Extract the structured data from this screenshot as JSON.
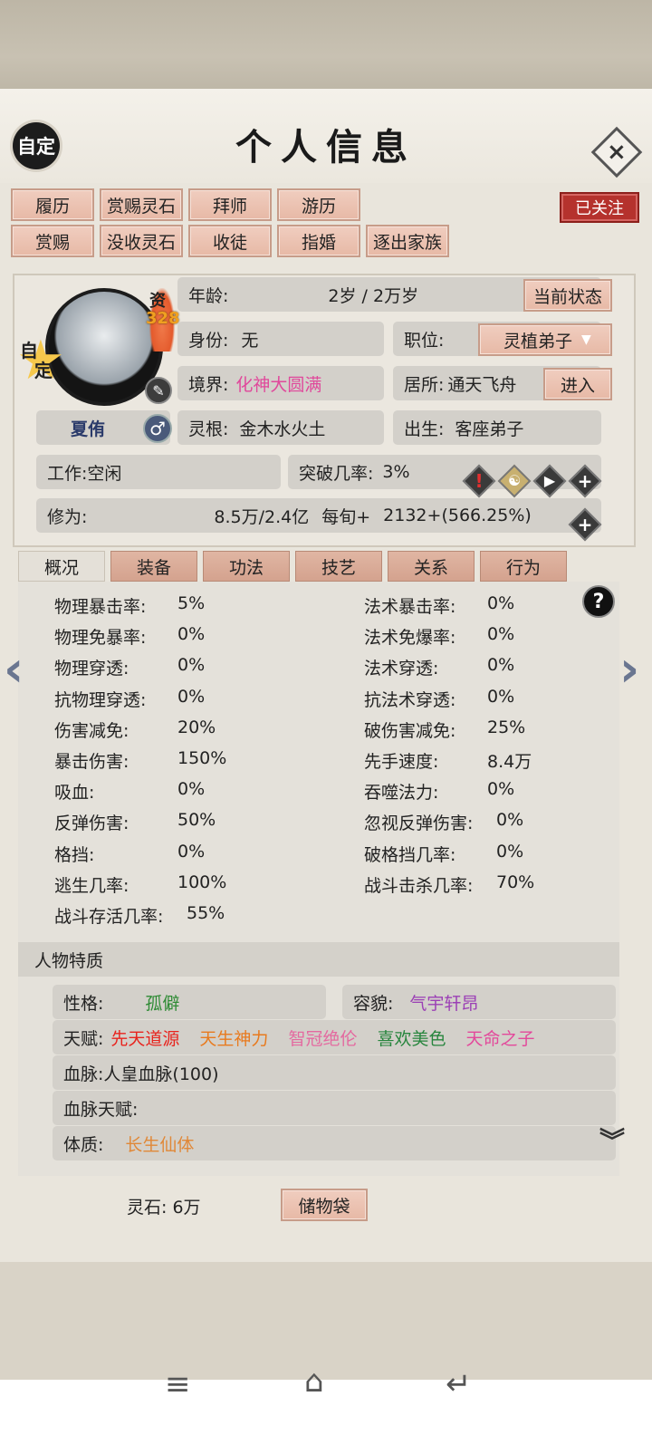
{
  "header": {
    "badge": "自定",
    "title": "个人信息",
    "close_icon": "×"
  },
  "follow_badge": "已关注",
  "action_buttons_row1": [
    "履历",
    "赏赐灵石",
    "拜师",
    "游历"
  ],
  "action_buttons_row2": [
    "赏赐",
    "没收灵石",
    "收徒",
    "指婚",
    "逐出家族"
  ],
  "character": {
    "star_badge_line1": "自",
    "star_badge_line2": "定",
    "aptitude_label": "资",
    "aptitude_value": "328",
    "name": "夏侑",
    "gender_icon": "♂"
  },
  "info": {
    "age_label": "年龄:",
    "age_value": "2岁 / 2万岁",
    "status_button": "当前状态",
    "identity_label": "身份:",
    "identity_value": "无",
    "position_label": "职位:",
    "position_value": "灵植弟子",
    "realm_label": "境界:",
    "realm_value": "化神大圆满",
    "residence_label": "居所:",
    "residence_value": "通天飞舟",
    "enter_button": "进入",
    "root_label": "灵根:",
    "root_value": "金木水火土",
    "birth_label": "出生:",
    "birth_value": "客座弟子",
    "work_label": "工作:",
    "work_value": "空闲",
    "break_label": "突破几率:",
    "break_value": "3%",
    "cult_label": "修为:",
    "cult_value": "8.5万/2.4亿",
    "per_turn_label": "每旬+",
    "per_turn_value": "2132+(566.25%)"
  },
  "tabs": [
    "概况",
    "装备",
    "功法",
    "技艺",
    "关系",
    "行为"
  ],
  "stats_left": [
    {
      "label": "物理暴击率:",
      "value": "5%"
    },
    {
      "label": "物理免暴率:",
      "value": "0%"
    },
    {
      "label": "物理穿透:",
      "value": "0%"
    },
    {
      "label": "抗物理穿透:",
      "value": "0%"
    },
    {
      "label": "伤害减免:",
      "value": "20%"
    },
    {
      "label": "暴击伤害:",
      "value": "150%"
    },
    {
      "label": "吸血:",
      "value": "0%"
    },
    {
      "label": "反弹伤害:",
      "value": "50%"
    },
    {
      "label": "格挡:",
      "value": "0%"
    },
    {
      "label": "逃生几率:",
      "value": "100%"
    },
    {
      "label": "战斗存活几率:",
      "value": "55%"
    }
  ],
  "stats_right": [
    {
      "label": "法术暴击率:",
      "value": "0%"
    },
    {
      "label": "法术免爆率:",
      "value": "0%"
    },
    {
      "label": "法术穿透:",
      "value": "0%"
    },
    {
      "label": "抗法术穿透:",
      "value": "0%"
    },
    {
      "label": "破伤害减免:",
      "value": "25%"
    },
    {
      "label": "先手速度:",
      "value": "8.4万"
    },
    {
      "label": "吞噬法力:",
      "value": "0%"
    },
    {
      "label": "忽视反弹伤害:",
      "value": "0%"
    },
    {
      "label": "破格挡几率:",
      "value": "0%"
    },
    {
      "label": "战斗击杀几率:",
      "value": "70%"
    }
  ],
  "traits": {
    "section_title": "人物特质",
    "personality_label": "性格:",
    "personality_value": "孤僻",
    "looks_label": "容貌:",
    "looks_value": "气宇轩昂",
    "talent_label": "天赋:",
    "talents": [
      "先天道源",
      "天生神力",
      "智冠绝伦",
      "喜欢美色",
      "天命之子"
    ],
    "blood_label": "血脉:",
    "blood_value": "人皇血脉(100)",
    "blood_talent_label": "血脉天赋:",
    "physique_label": "体质:",
    "physique_value": "长生仙体"
  },
  "footer": {
    "spirit_stone": "灵石: 6万",
    "bag_button": "储物袋"
  },
  "colors": {
    "accent_pink": "#e0489b",
    "follow_red": "#b5322d",
    "button_bg": "#e7b9a6"
  }
}
